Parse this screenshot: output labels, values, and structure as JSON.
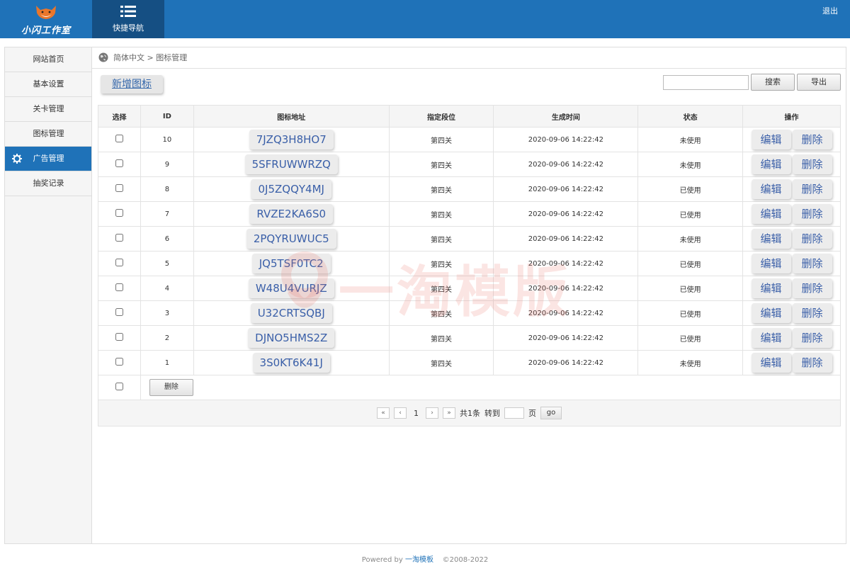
{
  "header": {
    "logo_text": "小闪工作室",
    "quicknav_label": "快捷导航",
    "logout": "退出"
  },
  "sidebar": {
    "items": [
      {
        "label": "网站首页"
      },
      {
        "label": "基本设置"
      },
      {
        "label": "关卡管理"
      },
      {
        "label": "图标管理"
      },
      {
        "label": "广告管理"
      },
      {
        "label": "抽奖记录"
      }
    ]
  },
  "breadcrumb": {
    "lang": "简体中文",
    "sep": ">",
    "current": "图标管理"
  },
  "toolbar": {
    "add_label": "新增图标",
    "search_label": "搜索",
    "export_label": "导出"
  },
  "table": {
    "headers": [
      "选择",
      "ID",
      "图标地址",
      "指定段位",
      "生成时间",
      "状态",
      "操作"
    ],
    "edit_label": "编辑",
    "delete_label": "删除",
    "rows": [
      {
        "id": "10",
        "code": "7JZQ3H8HO7",
        "level": "第四关",
        "time": "2020-09-06 14:22:42",
        "status": "未使用"
      },
      {
        "id": "9",
        "code": "5SFRUWWRZQ",
        "level": "第四关",
        "time": "2020-09-06 14:22:42",
        "status": "未使用"
      },
      {
        "id": "8",
        "code": "0J5ZQQY4MJ",
        "level": "第四关",
        "time": "2020-09-06 14:22:42",
        "status": "已使用"
      },
      {
        "id": "7",
        "code": "RVZE2KA6S0",
        "level": "第四关",
        "time": "2020-09-06 14:22:42",
        "status": "已使用"
      },
      {
        "id": "6",
        "code": "2PQYRUWUC5",
        "level": "第四关",
        "time": "2020-09-06 14:22:42",
        "status": "未使用"
      },
      {
        "id": "5",
        "code": "JQ5TSF0TC2",
        "level": "第四关",
        "time": "2020-09-06 14:22:42",
        "status": "已使用"
      },
      {
        "id": "4",
        "code": "W48U4VURJZ",
        "level": "第四关",
        "time": "2020-09-06 14:22:42",
        "status": "已使用"
      },
      {
        "id": "3",
        "code": "U32CRTSQBJ",
        "level": "第四关",
        "time": "2020-09-06 14:22:42",
        "status": "已使用"
      },
      {
        "id": "2",
        "code": "DJNO5HMS2Z",
        "level": "第四关",
        "time": "2020-09-06 14:22:42",
        "status": "已使用"
      },
      {
        "id": "1",
        "code": "3S0KT6K41J",
        "level": "第四关",
        "time": "2020-09-06 14:22:42",
        "status": "未使用"
      }
    ],
    "bulk_delete_label": "删除"
  },
  "pager": {
    "first": "«",
    "prev": "‹",
    "current": "1",
    "next": "›",
    "last": "»",
    "total_text": "共1条",
    "goto_text": "转到",
    "page_unit": "页",
    "go_label": "go"
  },
  "watermark": {
    "text": "一淘模版"
  },
  "footer": {
    "powered_prefix": "Powered by",
    "powered_link": "一淘模板",
    "copyright": "©2008-2022"
  },
  "colors": {
    "brand": "#1f72b8",
    "brand_dark": "#154f83",
    "link": "#3a5fa8"
  }
}
